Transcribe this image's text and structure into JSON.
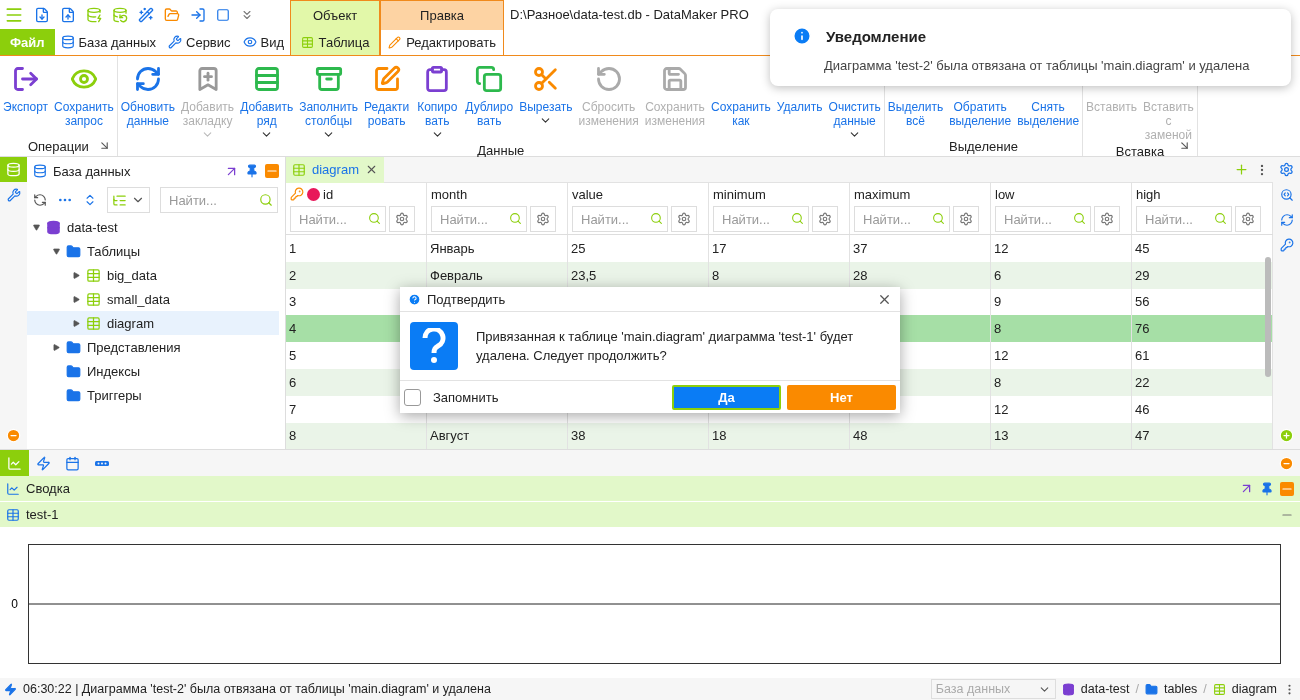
{
  "title": "D:\\Разное\\data-test.db - DataMaker PRO",
  "menu_tabs": [
    {
      "label": "Файл",
      "kind": "file",
      "selected": false
    },
    {
      "label": "База данных",
      "kind": "database",
      "selected": false
    },
    {
      "label": "Сервис",
      "kind": "tools",
      "selected": false
    },
    {
      "label": "Вид",
      "kind": "view",
      "selected": false
    }
  ],
  "context_tabs": [
    {
      "group": "Объект",
      "color": "#e2f8a9",
      "tab": {
        "label": "Таблица",
        "kind": "table",
        "selected": false
      }
    },
    {
      "group": "Правка",
      "color": "#fdd3a3",
      "tab": {
        "label": "Редактировать",
        "kind": "pencil",
        "selected": true
      }
    }
  ],
  "ribbon": [
    {
      "title": "Операции",
      "launcher": true,
      "buttons": [
        {
          "label": "Экспорт",
          "kind": "export",
          "disabled": false,
          "dropdown": false
        },
        {
          "label": "Сохранить\nзапрос",
          "kind": "eye",
          "disabled": false,
          "dropdown": false
        }
      ]
    },
    {
      "title": "Данные",
      "launcher": false,
      "buttons": [
        {
          "label": "Обновить\nданные",
          "kind": "refresh",
          "disabled": false,
          "dropdown": false
        },
        {
          "label": "Добавить\nзакладку",
          "kind": "bookmark",
          "disabled": true,
          "dropdown": true
        },
        {
          "label": "Добавить\nряд",
          "kind": "addrow",
          "disabled": false,
          "dropdown": true
        },
        {
          "label": "Заполнить\nстолбцы",
          "kind": "fill",
          "disabled": false,
          "dropdown": true
        },
        {
          "label": "Редакти\nровать",
          "kind": "edit",
          "disabled": false,
          "dropdown": false
        },
        {
          "label": "Копиро\nвать",
          "kind": "copy",
          "disabled": false,
          "dropdown": true
        },
        {
          "label": "Дублиро\nвать",
          "kind": "duplicate",
          "disabled": false,
          "dropdown": false
        },
        {
          "label": "Вырезать",
          "kind": "cut",
          "disabled": false,
          "dropdown": true
        },
        {
          "label": "Сбросить\nизменения",
          "kind": "reset",
          "disabled": true,
          "dropdown": false
        },
        {
          "label": "Сохранить\nизменения",
          "kind": "save",
          "disabled": true,
          "dropdown": false
        },
        {
          "label": "Сохранить\nкак",
          "kind": "plain",
          "disabled": false,
          "dropdown": false
        },
        {
          "label": "Удалить",
          "kind": "plain",
          "disabled": false,
          "dropdown": false
        },
        {
          "label": "Очистить\nданные",
          "kind": "plain",
          "disabled": false,
          "dropdown": true
        }
      ]
    },
    {
      "title": "Выделение",
      "launcher": false,
      "buttons": [
        {
          "label": "Выделить\nвсё",
          "kind": "plain",
          "disabled": false,
          "dropdown": false
        },
        {
          "label": "Обратить\nвыделение",
          "kind": "plain",
          "disabled": false,
          "dropdown": false
        },
        {
          "label": "Снять\nвыделение",
          "kind": "plain",
          "disabled": false,
          "dropdown": false
        }
      ]
    },
    {
      "title": "Вставка",
      "launcher": true,
      "buttons": [
        {
          "label": "Вставить",
          "kind": "plain",
          "disabled": true,
          "dropdown": false
        },
        {
          "label": "Вставить\nс\nзаменой",
          "kind": "plain",
          "disabled": true,
          "dropdown": false
        }
      ]
    }
  ],
  "notification": {
    "title": "Уведомление",
    "text": "Диаграмма 'test-2' была отвязана от таблицы 'main.diagram' и удалена"
  },
  "db_panel": {
    "title": "База данных",
    "search": {
      "placeholder": "Найти..."
    },
    "tree": [
      {
        "label": "data-test",
        "kind": "database",
        "expanded": true,
        "selected": false,
        "children": [
          {
            "label": "Таблицы",
            "kind": "folder",
            "expanded": true,
            "selected": false,
            "children": [
              {
                "label": "big_data",
                "kind": "table",
                "expanded": false,
                "selected": false
              },
              {
                "label": "small_data",
                "kind": "table",
                "expanded": false,
                "selected": false
              },
              {
                "label": "diagram",
                "kind": "table",
                "expanded": false,
                "selected": true
              }
            ]
          },
          {
            "label": "Представления",
            "kind": "folder",
            "expanded": false,
            "selected": false
          },
          {
            "label": "Индексы",
            "kind": "folder-leaf",
            "expanded": false,
            "selected": false
          },
          {
            "label": "Триггеры",
            "kind": "folder-leaf",
            "expanded": false,
            "selected": false
          }
        ]
      }
    ]
  },
  "grid": {
    "tab": {
      "label": "diagram",
      "selected": true
    },
    "columns": [
      {
        "name": "id",
        "key": true,
        "filter_placeholder": "Найти..."
      },
      {
        "name": "month",
        "key": false,
        "filter_placeholder": "Найти..."
      },
      {
        "name": "value",
        "key": false,
        "filter_placeholder": "Найти..."
      },
      {
        "name": "minimum",
        "key": false,
        "filter_placeholder": "Найти..."
      },
      {
        "name": "maximum",
        "key": false,
        "filter_placeholder": "Найти..."
      },
      {
        "name": "low",
        "key": false,
        "filter_placeholder": "Найти..."
      },
      {
        "name": "high",
        "key": false,
        "filter_placeholder": "Найти..."
      }
    ],
    "rows": [
      {
        "selected": false,
        "cells": [
          "1",
          "Январь",
          "25",
          "17",
          "37",
          "12",
          "45"
        ]
      },
      {
        "selected": false,
        "cells": [
          "2",
          "Февраль",
          "23,5",
          "8",
          "28",
          "6",
          "29"
        ]
      },
      {
        "selected": false,
        "cells": [
          "3",
          null,
          null,
          null,
          null,
          "9",
          "56"
        ]
      },
      {
        "selected": true,
        "cells": [
          "4",
          null,
          null,
          null,
          null,
          "8",
          "76"
        ]
      },
      {
        "selected": false,
        "cells": [
          "5",
          null,
          null,
          null,
          null,
          "12",
          "61"
        ]
      },
      {
        "selected": false,
        "cells": [
          "6",
          null,
          null,
          null,
          null,
          "8",
          "22"
        ]
      },
      {
        "selected": false,
        "cells": [
          "7",
          null,
          null,
          null,
          null,
          "12",
          "46"
        ]
      },
      {
        "selected": false,
        "cells": [
          "8",
          "Август",
          "38",
          "18",
          "48",
          "13",
          "47"
        ]
      }
    ]
  },
  "dialog": {
    "title": "Подтвердить",
    "message": "Привязанная к таблице 'main.diagram' диаграмма 'test-1' будет удалена. Следует продолжить?",
    "remember": {
      "label": "Запомнить",
      "checked": false
    },
    "buttons": [
      {
        "label": "Да",
        "kind": "primary"
      },
      {
        "label": "Нет",
        "kind": "secondary"
      }
    ]
  },
  "bottom_tabs": [
    {
      "kind": "chart",
      "selected": true
    },
    {
      "kind": "bolt",
      "selected": false
    },
    {
      "kind": "calendar",
      "selected": false
    },
    {
      "kind": "dots",
      "selected": false
    }
  ],
  "summary": {
    "title": "Сводка",
    "panel": {
      "title": "test-1"
    },
    "y_axis_label": "0"
  },
  "status_bar": {
    "message": "06:30:22 | Диаграмма 'test-2' была отвязана от таблицы 'main.diagram' и удалена",
    "db_select": {
      "placeholder": "База данных"
    },
    "breadcrumbs": [
      {
        "label": "data-test",
        "kind": "database"
      },
      {
        "label": "tables",
        "kind": "folder",
        "separator": "/"
      },
      {
        "label": "diagram",
        "kind": "table",
        "separator": "/"
      }
    ]
  }
}
